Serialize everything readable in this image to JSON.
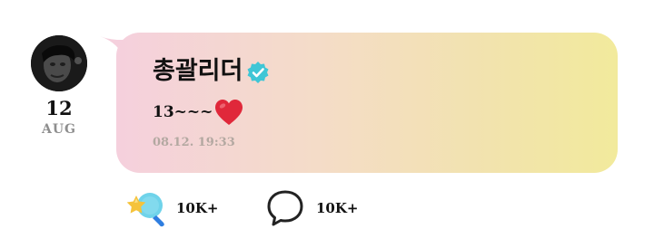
{
  "post": {
    "date_day": "12",
    "date_month": "AUG",
    "author_name": "총괄리더",
    "message": "13~~~",
    "timestamp": "08.12. 19:33"
  },
  "actions": {
    "like_count": "10K+",
    "comment_count": "10K+"
  },
  "icons": {
    "avatar": "avatar-photo",
    "verified": "verified-badge-icon",
    "heart": "red-heart-emoji",
    "like": "star-wand-icon",
    "comment": "speech-bubble-icon"
  },
  "colors": {
    "bubble_gradient_start": "#f5d0dd",
    "bubble_gradient_end": "#f2ea9c",
    "verified": "#3fc6d6",
    "heart": "#e0283a",
    "timestamp": "#b3a8a1",
    "month": "#8e8e8e"
  }
}
